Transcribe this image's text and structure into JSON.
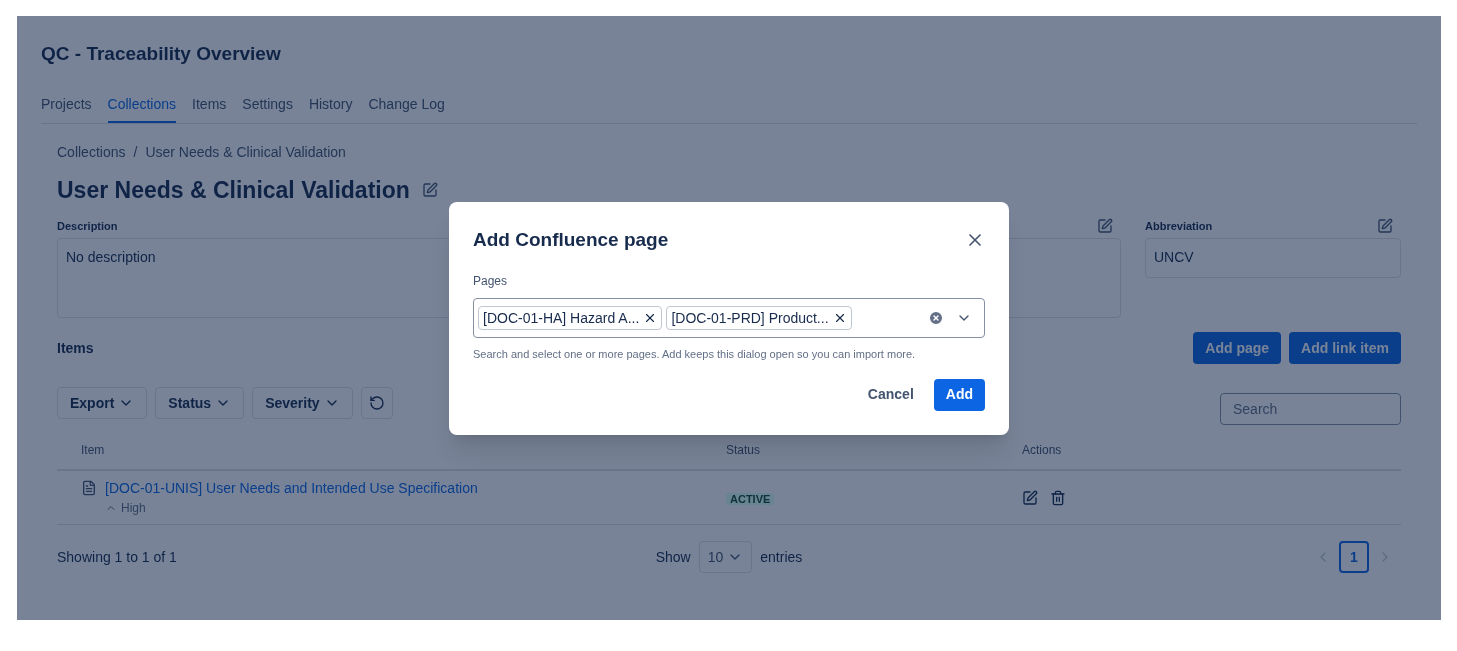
{
  "app_title": "QC - Traceability Overview",
  "tabs": [
    {
      "label": "Projects",
      "selected": false
    },
    {
      "label": "Collections",
      "selected": true
    },
    {
      "label": "Items",
      "selected": false
    },
    {
      "label": "Settings",
      "selected": false
    },
    {
      "label": "History",
      "selected": false
    },
    {
      "label": "Change Log",
      "selected": false
    }
  ],
  "breadcrumb": [
    "Collections",
    "User Needs & Clinical Validation"
  ],
  "breadcrumb_separator": "/",
  "page_title": "User Needs & Clinical Validation",
  "fields": [
    {
      "label": "Description",
      "value": "No description",
      "kind": "multiline"
    },
    {
      "label": "Abbreviation",
      "value": "UNCV",
      "kind": "single"
    }
  ],
  "items_section": {
    "title": "Items",
    "buttons": [
      "Add page",
      "Add link item"
    ],
    "filters": [
      "Export",
      "Status",
      "Severity"
    ],
    "search": {
      "placeholder": "Search"
    },
    "columns": [
      "Item",
      "Status",
      "Actions"
    ],
    "rows": [
      {
        "item": "[DOC-01-UNIS] User Needs and Intended Use Specification",
        "severity": "High",
        "status": "ACTIVE"
      }
    ],
    "showing": "Showing 1 to 1 of 1",
    "show_label": "Show",
    "page_size": "10",
    "entries_label": "entries",
    "pages": [
      {
        "label": "1",
        "selected": true
      }
    ]
  },
  "dialog": {
    "title": "Add Confluence page",
    "field_label": "Pages",
    "chips": [
      "[DOC-01-HA] Hazard A...",
      "[DOC-01-PRD] Product..."
    ],
    "help": "Search and select one or more pages. Add keeps this dialog open so you can import more.",
    "buttons": [
      {
        "label": "Cancel",
        "kind": "secondary"
      },
      {
        "label": "Add",
        "kind": "primary"
      }
    ]
  }
}
